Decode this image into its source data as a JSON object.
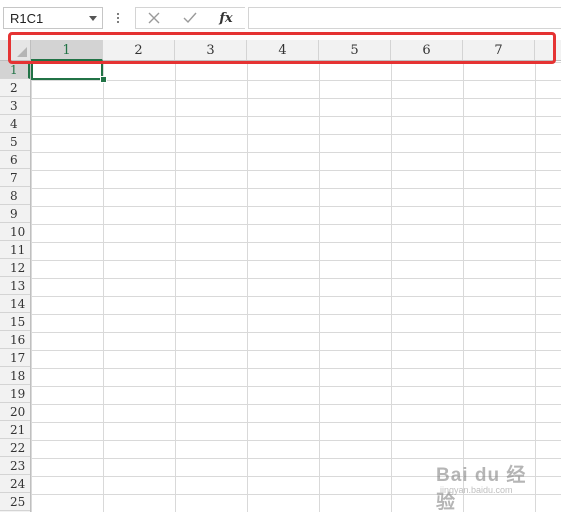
{
  "formula_bar": {
    "name_box": "R1C1",
    "cancel_icon": "cancel-icon",
    "enter_icon": "check-icon",
    "fx_label": "fx",
    "formula_value": ""
  },
  "sheet": {
    "column_headers": [
      "1",
      "2",
      "3",
      "4",
      "5",
      "6",
      "7"
    ],
    "row_headers": [
      "1",
      "2",
      "3",
      "4",
      "5",
      "6",
      "7",
      "8",
      "9",
      "10",
      "11",
      "12",
      "13",
      "14",
      "15",
      "16",
      "17",
      "18",
      "19",
      "20",
      "21",
      "22",
      "23",
      "24",
      "25"
    ],
    "selected_cell": "R1C1",
    "accent_color": "#217346"
  },
  "annotation": {
    "color": "#e53333"
  },
  "watermark": {
    "title": "Bai du 经验",
    "subtitle": "jingyan.baidu.com"
  }
}
